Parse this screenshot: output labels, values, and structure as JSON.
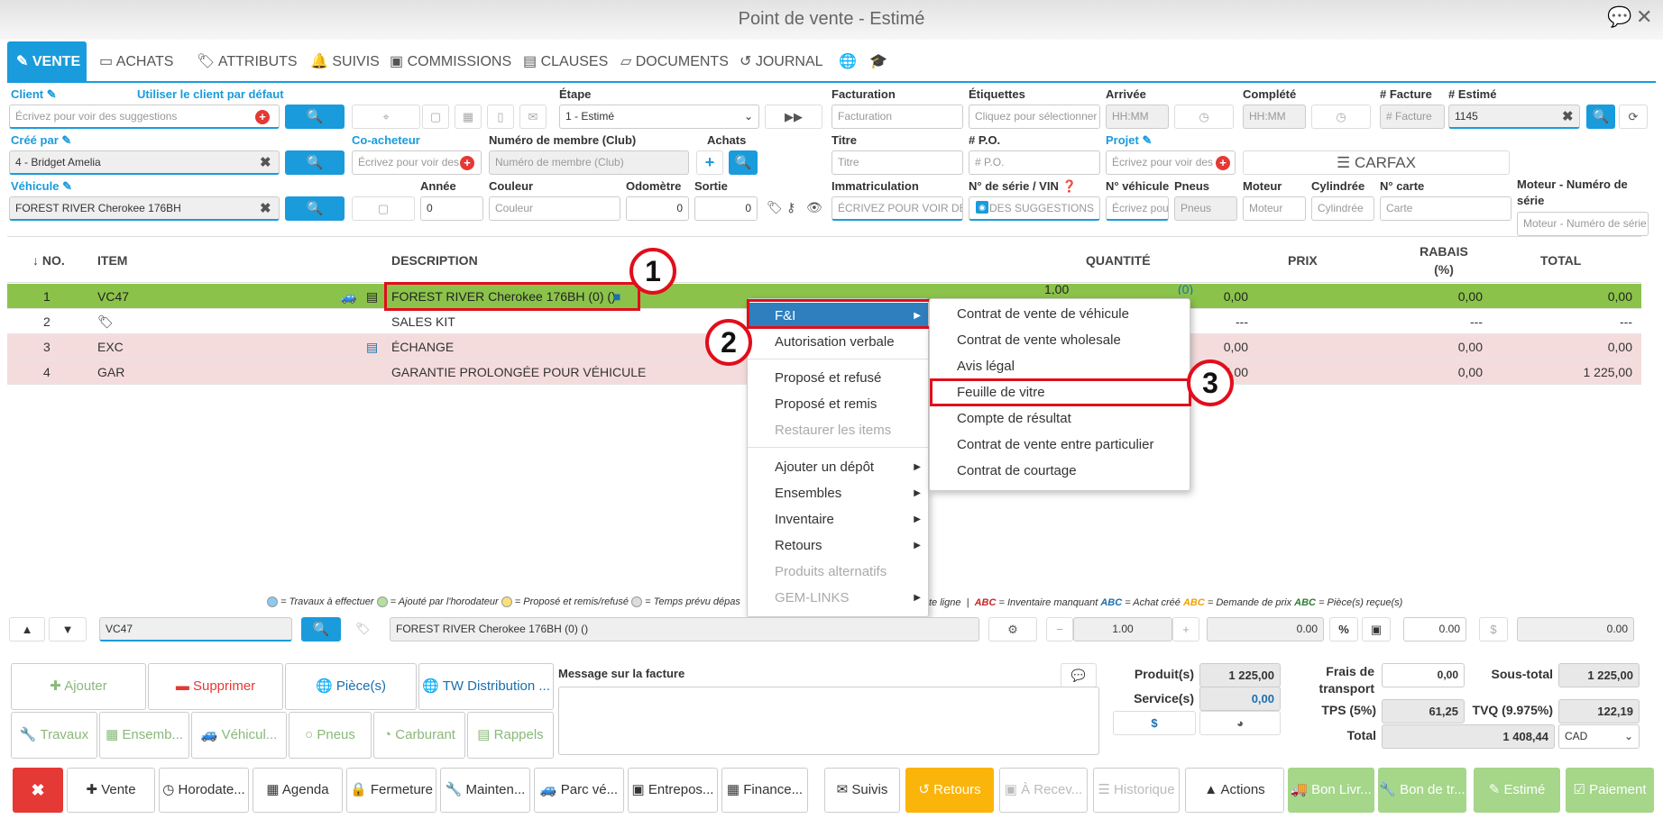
{
  "window": {
    "title": "Point de vente - Estimé"
  },
  "tabs": [
    {
      "label": "VENTE"
    },
    {
      "label": "ACHATS"
    },
    {
      "label": "ATTRIBUTS"
    },
    {
      "label": "SUIVIS"
    },
    {
      "label": "COMMISSIONS"
    },
    {
      "label": "CLAUSES"
    },
    {
      "label": "DOCUMENTS"
    },
    {
      "label": "JOURNAL"
    }
  ],
  "form": {
    "client_label": "Client",
    "use_default_client": "Utiliser le client par défaut",
    "client_placeholder": "Écrivez pour voir des suggestions",
    "etape_label": "Étape",
    "etape_value": "1 - Estimé",
    "facturation_label": "Facturation",
    "facturation_placeholder": "Facturation",
    "etiquettes_label": "Étiquettes",
    "etiquettes_placeholder": "Cliquez pour sélectionner",
    "arrivee_label": "Arrivée",
    "arrivee_placeholder": "HH:MM",
    "complete_label": "Complété",
    "complete_placeholder": "HH:MM",
    "facture_label": "# Facture",
    "facture_placeholder": "# Facture",
    "estime_label": "# Estimé",
    "estime_value": "1145",
    "cree_par_label": "Créé par",
    "cree_par_value": "4 - Bridget Amelia",
    "coacheteur_label": "Co-acheteur",
    "coacheteur_placeholder": "Écrivez pour voir des",
    "membre_label": "Numéro de membre (Club)",
    "membre_placeholder": "Numéro de membre (Club)",
    "achats_label": "Achats",
    "titre_label": "Titre",
    "titre_placeholder": "Titre",
    "po_label": "# P.O.",
    "po_placeholder": "# P.O.",
    "projet_label": "Projet",
    "projet_placeholder": "Écrivez pour voir des",
    "carfax": "CARFAX",
    "vehicule_label": "Véhicule",
    "vehicule_value": "FOREST RIVER Cherokee 176BH",
    "annee_label": "Année",
    "annee_value": "0",
    "couleur_label": "Couleur",
    "couleur_placeholder": "Couleur",
    "odometre_label": "Odomètre",
    "odometre_value": "0",
    "sortie_label": "Sortie",
    "sortie_value": "0",
    "immat_label": "Immatriculation",
    "immat_placeholder": "ÉCRIVEZ POUR VOIR DES",
    "serie_label": "N° de série / VIN",
    "serie_placeholder": "DES SUGGESTIONS",
    "nveh_label": "N° véhicule",
    "nveh_placeholder": "Écrivez pou",
    "pneus_label": "Pneus",
    "pneus_placeholder": "Pneus",
    "moteur_label": "Moteur",
    "moteur_placeholder": "Moteur",
    "cylindree_label": "Cylindrée",
    "cylindree_placeholder": "Cylindrée",
    "carte_label": "N° carte",
    "carte_placeholder": "Carte",
    "moteur_num_label_1": "Moteur - Numéro de",
    "moteur_num_label_2": "série",
    "moteur_num_placeholder": "Moteur - Numéro de série"
  },
  "table": {
    "headers": {
      "no": "↓ NO.",
      "item": "ITEM",
      "description": "DESCRIPTION",
      "quantite": "QUANTITÉ",
      "prix": "PRIX",
      "rabais_1": "RABAIS",
      "rabais_2": "(%)",
      "total": "TOTAL"
    },
    "rows": [
      {
        "no": "1",
        "item": "VC47",
        "description": "FOREST RIVER Cherokee 176BH (0) ()",
        "quantite": "1,00",
        "qty_note": "(0)",
        "prix": "0,00",
        "rabais": "0,00",
        "total": "0,00"
      },
      {
        "no": "2",
        "item": "",
        "description": "SALES KIT",
        "prix": "---",
        "rabais": "---",
        "total": "---"
      },
      {
        "no": "3",
        "item": "EXC",
        "description": "ÉCHANGE",
        "prix": "0,00",
        "rabais": "0,00",
        "total": "0,00"
      },
      {
        "no": "4",
        "item": "GAR",
        "description": "GARANTIE PROLONGÉE POUR VÉHICULE",
        "prix": "1 225,00",
        "rabais": "0,00",
        "total": "1 225,00"
      }
    ]
  },
  "context_menu": {
    "items": [
      "F&I",
      "Autorisation verbale",
      "Proposé et refusé",
      "Proposé et remis",
      "Restaurer les items",
      "Ajouter un dépôt",
      "Ensembles",
      "Inventaire",
      "Retours",
      "Produits alternatifs",
      "GEM-LINKS"
    ]
  },
  "submenu": {
    "items": [
      "Contrat de vente de véhicule",
      "Contrat de vente wholesale",
      "Avis légal",
      "Feuille de vitre",
      "Compte de résultat",
      "Contrat de vente entre particulier",
      "Contrat de courtage"
    ]
  },
  "callouts": [
    "1",
    "2",
    "3"
  ],
  "legend": {
    "a": "= Travaux à effectuer",
    "b": "= Ajouté par l'horodateur",
    "c": "= Proposé et remis/refusé",
    "d": "= Temps prévu dépas",
    "e": "te ligne",
    "abc": "ABC",
    "f": "= Inventaire manquant",
    "g": "= Achat créé",
    "h": "= Demande de prix",
    "i": "= Pièce(s) reçue(s)"
  },
  "editbar": {
    "item_value": "VC47",
    "desc_value": "FOREST RIVER Cherokee 176BH (0) ()",
    "qty": "1.00",
    "price": "0.00",
    "percent": "%",
    "rabais": "0.00",
    "dollar": "$",
    "total": "0.00"
  },
  "actions": {
    "ajouter": "Ajouter",
    "supprimer": "Supprimer",
    "pieces": "Pièce(s)",
    "tw": "TW Distribution ...",
    "travaux": "Travaux",
    "ensembles": "Ensemb...",
    "vehicules": "Véhicul...",
    "pneus": "Pneus",
    "carburant": "Carburant",
    "rappels": "Rappels"
  },
  "message": {
    "label": "Message sur la facture"
  },
  "totals": {
    "produits_label": "Produit(s)",
    "produits": "1 225,00",
    "services_label": "Service(s)",
    "services": "0,00",
    "frais_label_1": "Frais de",
    "frais_label_2": "transport",
    "frais": "0,00",
    "soustotal_label": "Sous-total",
    "soustotal": "1 225,00",
    "tps_label": "TPS (5%)",
    "tps": "61,25",
    "tvq_label": "TVQ (9.975%)",
    "tvq": "122,19",
    "total_label": "Total",
    "total": "1 408,44",
    "currency": "CAD",
    "dollar": "$"
  },
  "footer": {
    "close": "✖",
    "vente": "Vente",
    "horodateur": "Horodate...",
    "agenda": "Agenda",
    "fermeture": "Fermeture",
    "maintenance": "Mainten...",
    "parc": "Parc vé...",
    "entrepos": "Entrepos...",
    "finance": "Finance...",
    "suivis": "Suivis",
    "retours": "Retours",
    "arecevoir": "À Recev...",
    "historique": "Historique",
    "actions": "Actions",
    "bonlivr": "Bon Livr...",
    "bontr": "Bon de tr...",
    "estime": "Estimé",
    "paiement": "Paiement"
  },
  "colors": {
    "accent": "#1a9bdc",
    "row_selected": "#8bc34a",
    "row_pink": "#f5dcdc",
    "red": "#e10e1c",
    "orange": "#fbb40a",
    "green_btn": "#a5d68a"
  }
}
